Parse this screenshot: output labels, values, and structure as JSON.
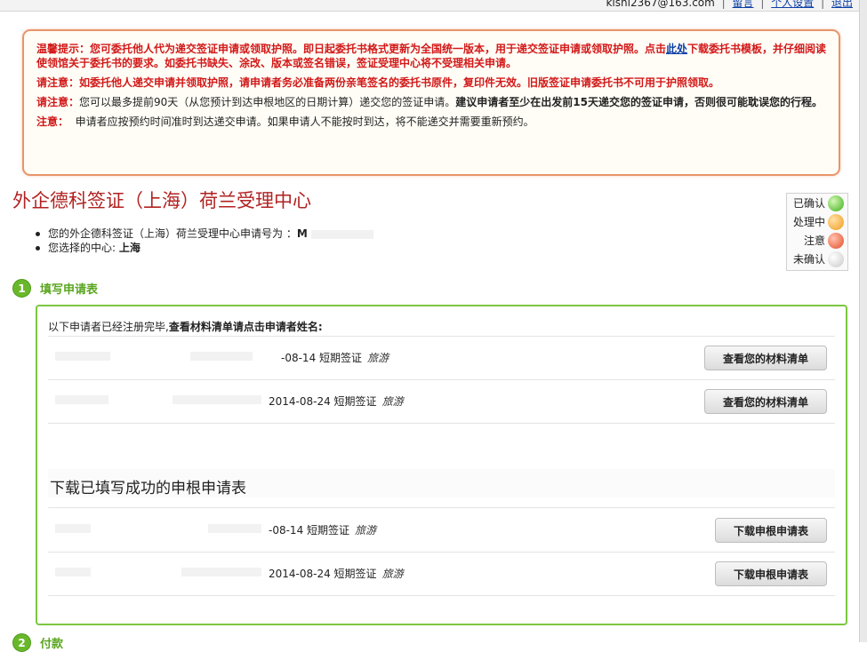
{
  "topbar": {
    "user_email": "kishi2367@163.com",
    "links": [
      "留言",
      "个人设置",
      "退出"
    ]
  },
  "notice": {
    "p1_before": "温馨提示：您可委托他人代为递交签证申请或领取护照。即日起委托书格式更新为全国统一版本，用于递交签证申请或领取护照。点击",
    "p1_link": "此处",
    "p1_after": "下载委托书模板，并仔细阅读使领馆关于委托书的要求。如委托书缺失、涂改、版本或签名错误，签证受理中心将不受理相关申请。",
    "p2": "请注意：如委托他人递交申请并领取护照，请申请者务必准备两份亲笔签名的委托书原件，复印件无效。旧版签证申请委托书不可用于护照领取。",
    "p3_lead": "请注意：",
    "p3_text": "您可以最多提前90天（从您预计到达申根地区的日期计算）递交您的签证申请。",
    "p3_bold": "建议申请者至少在出发前15天递交您的签证申请，否则很可能耽误您的行程。",
    "p4_lead": "注意：",
    "p4_text": "申请者应按预约时间准时到达递交申请。如果申请人不能按时到达，将不能递交并需要重新预约。"
  },
  "center": {
    "title": "外企德科签证（上海）荷兰受理中心",
    "app_no_label": "您的外企德科签证（上海）荷兰受理中心申请号为 ：",
    "app_no_value": "M",
    "chosen_label": "您选择的中心: ",
    "chosen_value": "上海"
  },
  "legend": [
    {
      "label": "已确认",
      "color": "green"
    },
    {
      "label": "处理中",
      "color": "orange"
    },
    {
      "label": "注意",
      "color": "red"
    },
    {
      "label": "未确认",
      "color": "gray"
    }
  ],
  "step1": {
    "number": "1",
    "label": "填写申请表"
  },
  "step2": {
    "number": "2",
    "label": "付款"
  },
  "panel": {
    "intro_plain": "以下申请者已经注册完毕,",
    "intro_bold": "查看材料清单请点击申请者姓名:",
    "checklist_rows": [
      {
        "text": "-08-14 短期签证",
        "purpose": "旅游",
        "button": "查看您的材料清单"
      },
      {
        "text": "2014-08-24 短期签证",
        "purpose": "旅游",
        "button": "查看您的材料清单"
      }
    ],
    "download_heading": "下载已填写成功的申根申请表",
    "download_rows": [
      {
        "text": "-08-14 短期签证",
        "purpose": "旅游",
        "button": "下载申根申请表"
      },
      {
        "text": "2014-08-24 短期签证",
        "purpose": "旅游",
        "button": "下载申根申请表"
      }
    ]
  }
}
